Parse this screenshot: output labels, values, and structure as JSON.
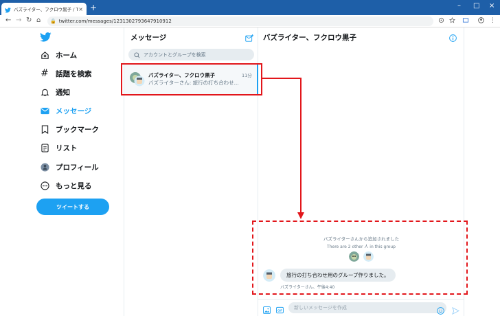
{
  "browser": {
    "tab_title": "バズライター、フクロウ黒子 / Twitter",
    "tab_close": "×",
    "new_tab": "+",
    "url": "twitter.com/messages/1231302793647910912",
    "window_controls": [
      "–",
      "□",
      "×"
    ],
    "nav_icons": [
      "←",
      "→",
      "↻",
      "⌂"
    ]
  },
  "sidebar": {
    "items": [
      {
        "label": "ホーム",
        "icon": "home-icon"
      },
      {
        "label": "話題を検索",
        "icon": "hashtag-icon"
      },
      {
        "label": "通知",
        "icon": "bell-icon"
      },
      {
        "label": "メッセージ",
        "icon": "envelope-icon"
      },
      {
        "label": "ブックマーク",
        "icon": "bookmark-icon"
      },
      {
        "label": "リスト",
        "icon": "list-icon"
      },
      {
        "label": "プロフィール",
        "icon": "avatar-icon"
      },
      {
        "label": "もっと見る",
        "icon": "more-icon"
      }
    ],
    "tweet_button": "ツイートする",
    "active_color": "#1da1f2"
  },
  "messages": {
    "heading": "メッセージ",
    "search_placeholder": "アカウントとグループを検索",
    "item": {
      "name": "バズライター、フクロウ黒子",
      "time": "11分",
      "preview": "バズライターさん: 旅行の打ち合わせ..."
    }
  },
  "conversation": {
    "title": "バズライター、フクロウ黒子",
    "system_added": "バズライターさんから追加されました",
    "system_others": "There are 2 other 人 in this group",
    "message_text": "旅行の打ち合わせ用のグループ作りました。",
    "message_meta": "バズライターさん、午後4:40",
    "input_placeholder": "新しいメッセージを作成"
  },
  "colors": {
    "accent": "#1da1f2",
    "annotation": "#e2161b"
  }
}
